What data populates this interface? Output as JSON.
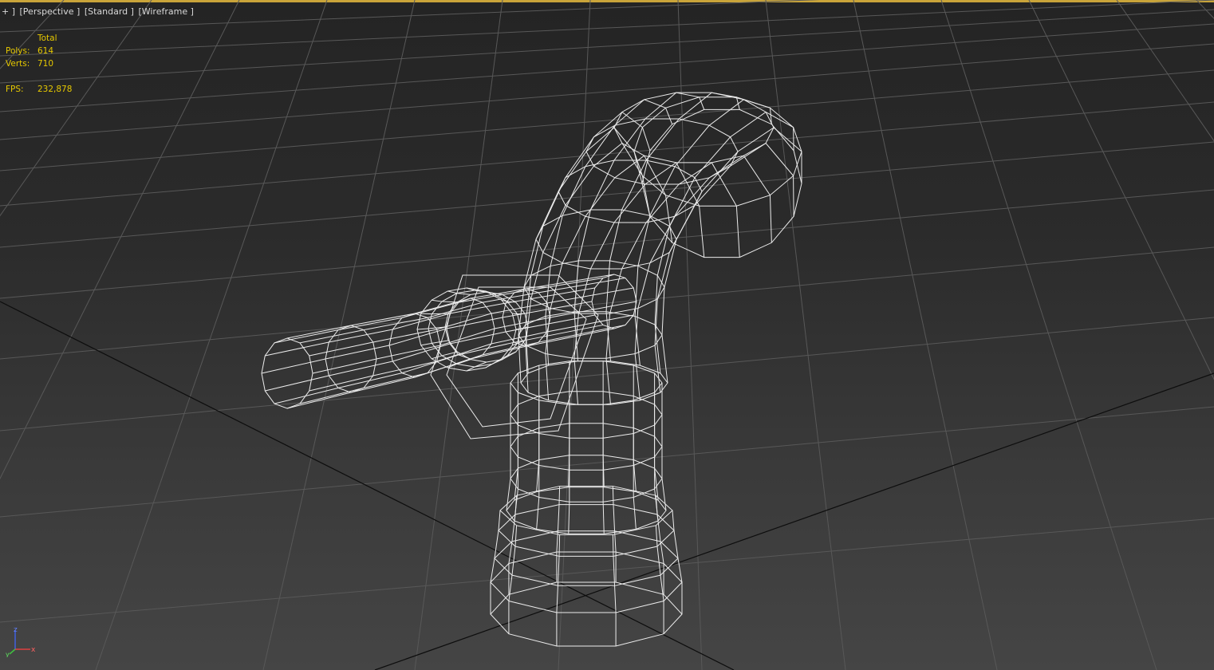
{
  "viewport": {
    "labels": [
      "+ ]",
      "[Perspective ]",
      "[Standard ]",
      "[Wireframe ]"
    ],
    "accent_color": "#c9a43a",
    "stats_color": "#e6c800"
  },
  "stats": {
    "header": "Total",
    "polys_label": "Polys:",
    "polys_value": "614",
    "verts_label": "Verts:",
    "verts_value": "710",
    "fps_label": "FPS:",
    "fps_value": "232,878"
  },
  "axis_tripod": {
    "x_label": "x",
    "y_label": "y",
    "z_label": "z",
    "x_color": "#e04040",
    "y_color": "#40c040",
    "z_color": "#4060e0"
  },
  "scene": {
    "object": "faucet-wireframe",
    "grid": "home-grid"
  }
}
